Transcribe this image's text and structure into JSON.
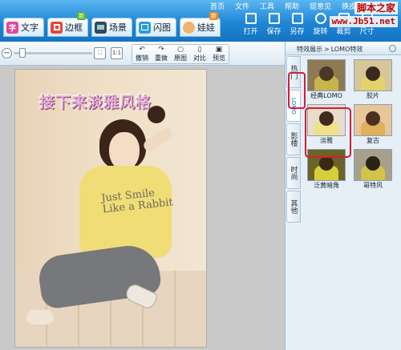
{
  "top_menu": [
    "首页",
    "文件",
    "工具",
    "帮助",
    "提意见",
    "换皮肤"
  ],
  "watermark": {
    "line1": "脚本之家",
    "line2": "www.Jb51.net"
  },
  "tabs": [
    {
      "label": "文字",
      "icon": "字",
      "badge": ""
    },
    {
      "label": "边框",
      "icon": "",
      "badge": "新"
    },
    {
      "label": "场景",
      "icon": "",
      "badge": ""
    },
    {
      "label": "闪图",
      "icon": "",
      "badge": ""
    },
    {
      "label": "娃娃",
      "icon": "",
      "badge": "新"
    }
  ],
  "tools": [
    "打开",
    "保存",
    "另存",
    "旋转",
    "裁剪",
    "尺寸"
  ],
  "canvas_toolbar": {
    "zoom_minus": "−",
    "fit_label": "",
    "one_to_one": "1:1",
    "edit": [
      {
        "label": "撤销",
        "icon": "↶"
      },
      {
        "label": "重做",
        "icon": "↷"
      },
      {
        "label": "原图",
        "icon": "○"
      },
      {
        "label": "对比",
        "icon": "▯"
      },
      {
        "label": "预览",
        "icon": "▣"
      }
    ]
  },
  "photo": {
    "overlay_text": "接下来淡雅风格",
    "shirt_text": "Just Smile\nLike a Rabbit"
  },
  "panel": {
    "breadcrumb_root": "特效展示",
    "breadcrumb_sep": ">",
    "breadcrumb_current": "LOMO特效",
    "vtabs": [
      "热门",
      "LOMO",
      "影楼",
      "时尚",
      "其他"
    ],
    "effects": [
      {
        "label": "经典LOMO",
        "g": "#4c3624",
        "b": "#c7b54c",
        "bg": "#8e7a52"
      },
      {
        "label": "胶片",
        "g": "#3a2a1e",
        "b": "#e6d26a",
        "bg": "#d5c79a"
      },
      {
        "label": "淡雅",
        "g": "#3f2a1f",
        "b": "#efe08a",
        "bg": "#e9dcc8"
      },
      {
        "label": "复古",
        "g": "#4a311f",
        "b": "#e0b05a",
        "bg": "#e7c69a"
      },
      {
        "label": "泛黄暗角",
        "g": "#3a2a14",
        "b": "#d7cf3a",
        "bg": "#6c6327"
      },
      {
        "label": "哥特风",
        "g": "#2a2418",
        "b": "#d2c34a",
        "bg": "#a7a08a"
      }
    ]
  },
  "colors": {
    "accent": "#1e86d6",
    "highlight": "#d21e35"
  }
}
